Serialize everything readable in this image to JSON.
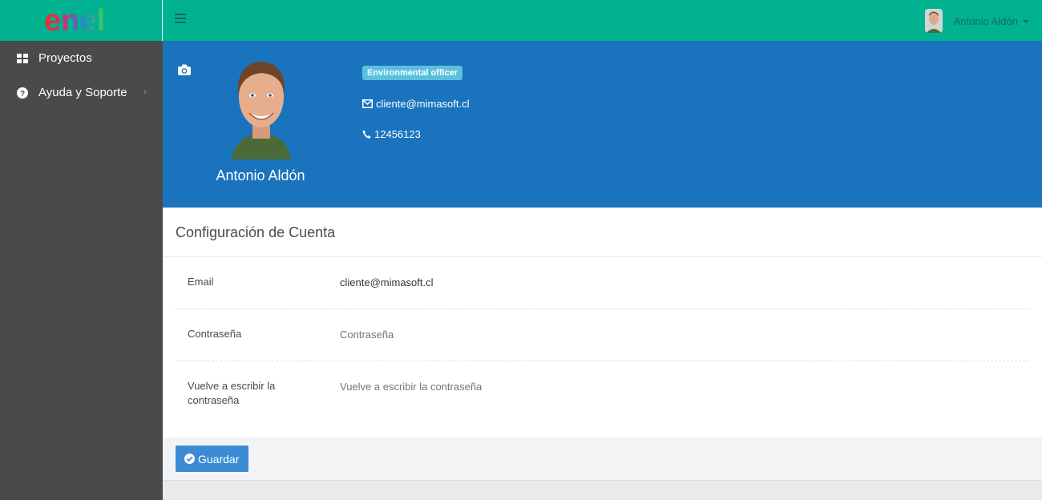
{
  "header": {
    "logo_text": "enel",
    "user_name": "Antonio Aldón"
  },
  "sidebar": {
    "items": [
      {
        "label": "Proyectos",
        "icon": "grid-icon"
      },
      {
        "label": "Ayuda y Soporte",
        "icon": "question-circle-icon"
      }
    ]
  },
  "profile": {
    "name": "Antonio Aldón",
    "role": "Environmental officer",
    "email": "cliente@mimasoft.cl",
    "phone": "12456123"
  },
  "account": {
    "title": "Configuración de Cuenta",
    "email_label": "Email",
    "email_value": "cliente@mimasoft.cl",
    "password_label": "Contraseña",
    "password_placeholder": "Contraseña",
    "retype_label": "Vuelve a escribir la contraseña",
    "retype_placeholder": "Vuelve a escribir la contraseña",
    "save_label": "Guardar"
  },
  "colors": {
    "topbar": "#00b28f",
    "sidebar": "#4a4a4a",
    "banner": "#1a73bd",
    "badge": "#5bc0de",
    "button": "#3a8bd3"
  }
}
